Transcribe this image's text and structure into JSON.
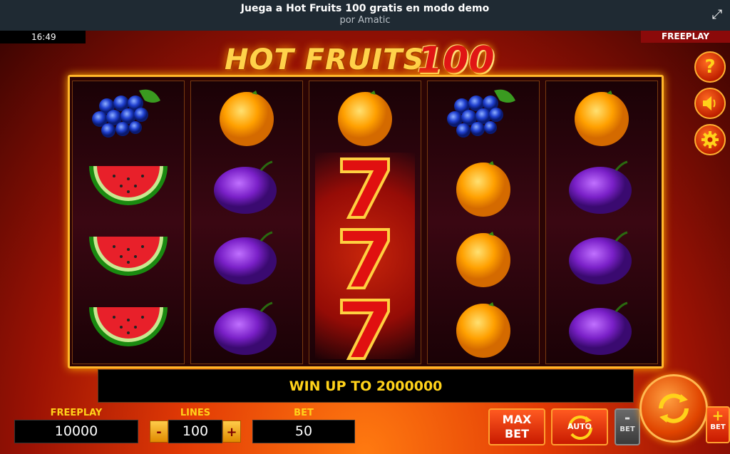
{
  "header": {
    "title": "Juega a Hot Fruits 100 gratis en modo demo",
    "subtitle": "por Amatic"
  },
  "status": {
    "clock": "16:49",
    "mode_tag": "FREEPLAY"
  },
  "logo": {
    "word": "HOT FRUITS",
    "number": "100"
  },
  "reels": [
    [
      "grapes",
      "watermelon",
      "watermelon",
      "watermelon"
    ],
    [
      "orange",
      "plum",
      "plum",
      "plum"
    ],
    [
      "orange",
      "seven",
      "seven",
      "seven"
    ],
    [
      "grapes",
      "orange",
      "orange",
      "orange"
    ],
    [
      "orange",
      "plum",
      "plum",
      "plum"
    ]
  ],
  "win_message": "WIN UP TO 2000000",
  "controls": {
    "freeplay_label": "FREEPLAY",
    "freeplay_value": "10000",
    "lines_label": "LINES",
    "lines_value": "100",
    "bet_label": "BET",
    "bet_value": "50",
    "minus": "-",
    "plus": "+",
    "max_bet_line1": "MAX",
    "max_bet_line2": "BET",
    "auto_label": "AUTO",
    "bet_minus_label": "BET",
    "bet_plus_label": "BET"
  },
  "side_buttons": [
    "help-icon",
    "sound-icon",
    "settings-icon"
  ],
  "colors": {
    "accent": "#ffd21a",
    "frame": "#ffb52a"
  }
}
